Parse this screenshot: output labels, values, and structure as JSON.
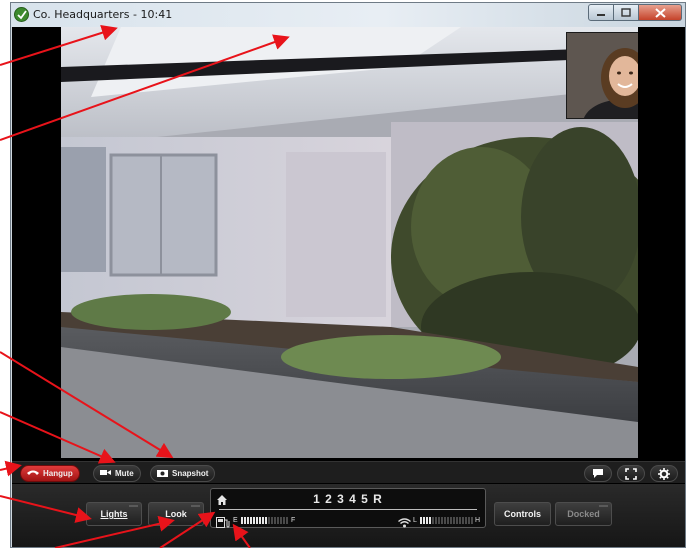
{
  "window": {
    "title": "Co. Headquarters - 10:41",
    "controls": [
      "minimize-icon",
      "maximize-icon",
      "close-icon"
    ]
  },
  "toolbar": {
    "hangup_label": "Hangup",
    "mute_label": "Mute",
    "snapshot_label": "Snapshot",
    "right_icons": [
      "chat-icon",
      "fullscreen-icon",
      "gear-icon"
    ]
  },
  "controls": {
    "lights_label": "Lights",
    "look_label": "Look",
    "controls_label": "Controls",
    "docked_label": "Docked",
    "floors": "1 2 3 4 5 R",
    "battery": {
      "empty_label": "E",
      "full_label": "F",
      "level": 0.55
    },
    "wifi": {
      "low_label": "L",
      "high_label": "H",
      "level": 0.22
    }
  },
  "colors": {
    "hangup": "#c91f1f",
    "annotation_arrow": "#e8131a",
    "app_icon": "#3d8a2e"
  }
}
